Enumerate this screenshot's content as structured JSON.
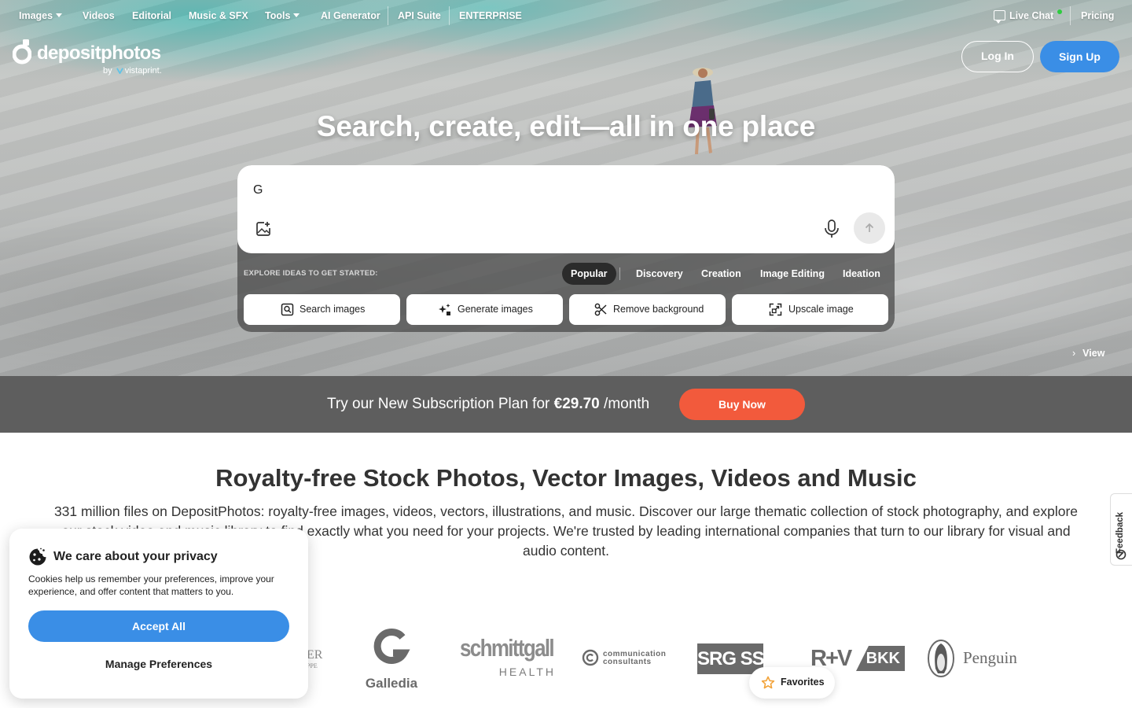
{
  "nav": {
    "items": [
      "Images",
      "Videos",
      "Editorial",
      "Music & SFX",
      "Tools",
      "AI Generator",
      "API Suite",
      "ENTERPRISE"
    ],
    "live_chat": "Live Chat",
    "pricing": "Pricing"
  },
  "logo": {
    "name": "depositphotos",
    "by": "by",
    "partner": "vistaprint."
  },
  "auth": {
    "login": "Log In",
    "signup": "Sign Up"
  },
  "hero": {
    "headline": "Search, create, edit—all in one place",
    "search_value": "G",
    "explore_label": "EXPLORE IDEAS TO GET STARTED:",
    "tabs": [
      "Popular",
      "Discovery",
      "Creation",
      "Image Editing",
      "Ideation"
    ],
    "active_tab": "Popular",
    "quick_actions": [
      "Search images",
      "Generate images",
      "Remove background",
      "Upscale image"
    ],
    "view_link": "View"
  },
  "promo": {
    "text": "Try our New Subscription Plan for",
    "price": "€29.70",
    "period": "/month",
    "cta": "Buy Now"
  },
  "main": {
    "title": "Royalty-free Stock Photos, Vector Images, Videos and Music",
    "description": "331 million files on DepositPhotos: royalty-free images, videos, vectors, illustrations, and music. Discover our large thematic collection of stock photography, and explore our stock video and music library to find exactly what you need for your projects. We're trusted by leading international companies that turn to our library for visual and audio content."
  },
  "brands": {
    "partial_top": "ER",
    "partial_bottom": "PPE",
    "galledia": "Galledia",
    "schmittgall": "schmittgall",
    "schmittgall_sub": "HEALTH",
    "comm_line1": "communication",
    "comm_line2": "consultants",
    "srg": "SRG SSR",
    "rhv": "R+V",
    "bkk": "BKK",
    "penguin": "Penguin"
  },
  "feedback": "Feedback",
  "cookie": {
    "title": "We care about your privacy",
    "text": "Cookies help us remember your preferences, improve your experience, and offer content that matters to you.",
    "accept": "Accept All",
    "manage": "Manage Preferences"
  },
  "favorites": "Favorites",
  "colors": {
    "accent_blue": "#3a8ee6",
    "buy_orange": "#f25a3c",
    "promo_bg": "#5e5e5e",
    "status_green": "#2ecc40"
  },
  "icons": [
    "chevron-down-icon",
    "chat-icon",
    "logo-mark-icon",
    "image-upload-icon",
    "microphone-icon",
    "arrow-up-icon",
    "search-image-icon",
    "sparkle-icon",
    "scissors-icon",
    "upscale-icon",
    "chevron-right-icon",
    "cookie-icon",
    "star-icon",
    "feedback-icon"
  ]
}
